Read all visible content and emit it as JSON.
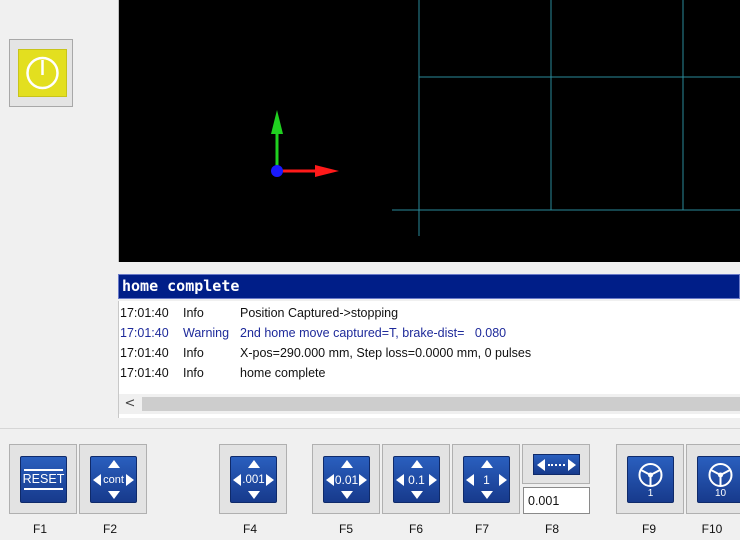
{
  "power_button": {
    "icon": "power-icon"
  },
  "status": {
    "text": "home complete"
  },
  "log": {
    "rows": [
      {
        "time": "17:01:40",
        "level": "Info",
        "message": "Position Captured->stopping"
      },
      {
        "time": "17:01:40",
        "level": "Warning",
        "message": "2nd home move captured=T, brake-dist=   0.080"
      },
      {
        "time": "17:01:40",
        "level": "Info",
        "message": "X-pos=290.000 mm, Step loss=0.0000 mm, 0 pulses"
      },
      {
        "time": "17:01:40",
        "level": "Info",
        "message": "home complete"
      }
    ],
    "scroll_left": "<"
  },
  "toolbar": {
    "f1": {
      "label": "RESET",
      "key": "F1"
    },
    "f2": {
      "label": "cont",
      "key": "F2"
    },
    "f4": {
      "label": ".001",
      "key": "F4"
    },
    "f5": {
      "label": "0.01",
      "key": "F5"
    },
    "f6": {
      "label": "0.1",
      "key": "F6"
    },
    "f7": {
      "label": "1",
      "key": "F7"
    },
    "f8": {
      "key": "F8",
      "input_value": "0.001"
    },
    "f9": {
      "label": "1",
      "key": "F9",
      "icon": "handwheel-icon"
    },
    "f10": {
      "label": "10",
      "key": "F10",
      "icon": "handwheel-icon"
    }
  },
  "colors": {
    "status_bar": "#001e88",
    "warning_text": "#1e2a9a",
    "power_face": "#e3df1f",
    "button_face": "#1f4ba8",
    "axis_x": "#ff1a1a",
    "axis_y": "#20d020",
    "axis_z": "#1a1aff",
    "grid": "#2a8a9a"
  }
}
